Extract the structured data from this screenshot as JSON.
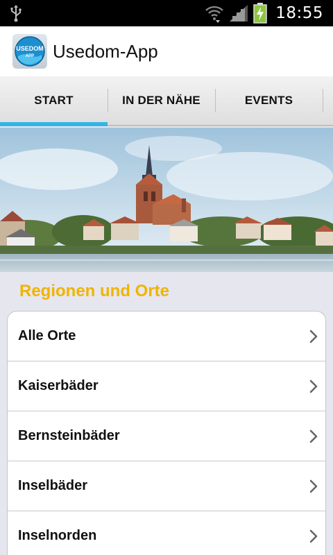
{
  "status_bar": {
    "time": "18:55",
    "icons": [
      "usb-icon",
      "wifi-icon",
      "signal-icon",
      "battery-charging-icon"
    ]
  },
  "app_bar": {
    "title": "Usedom-App",
    "logo_text_line1": "USEDOM",
    "logo_text_line2": "APP"
  },
  "tabs": [
    {
      "label": "START",
      "active": true
    },
    {
      "label": "IN DER NÄHE",
      "active": false
    },
    {
      "label": "EVENTS",
      "active": false
    }
  ],
  "section": {
    "title": "Regionen und Orte"
  },
  "list": {
    "items": [
      {
        "label": "Alle Orte"
      },
      {
        "label": "Kaiserbäder"
      },
      {
        "label": "Bernsteinbäder"
      },
      {
        "label": "Inselbäder"
      },
      {
        "label": "Inselnorden"
      }
    ]
  },
  "colors": {
    "accent_tab_indicator": "#33b5e5",
    "section_title": "#f0b400",
    "battery": "#8cc63f"
  }
}
